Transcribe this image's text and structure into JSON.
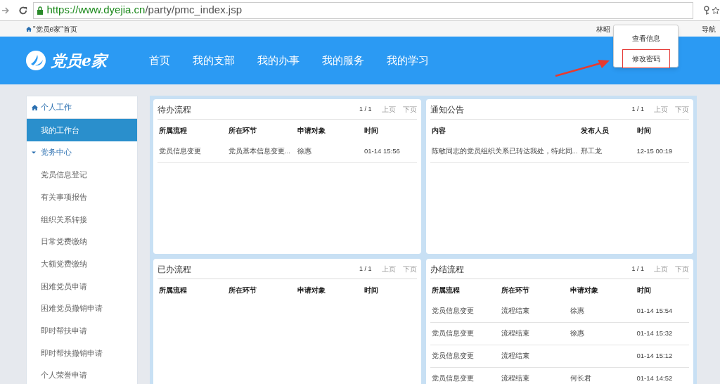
{
  "browser": {
    "url_host": "https://www.dyejia.cn",
    "url_path": "/party/pmc_index.jsp"
  },
  "topbar": {
    "breadcrumb": "\"党员e家\"首页",
    "user": "林昭",
    "right_link": "导航"
  },
  "user_menu": {
    "items": [
      {
        "label": "查看信息",
        "selected": false
      },
      {
        "label": "修改密码",
        "selected": true
      }
    ]
  },
  "header": {
    "logo": "党员e家",
    "nav": [
      {
        "label": "首页",
        "selected": false
      },
      {
        "label": "我的支部",
        "selected": false
      },
      {
        "label": "我的办事",
        "selected": false
      },
      {
        "label": "我的服务",
        "selected": false
      },
      {
        "label": "我的学习",
        "selected": false
      }
    ]
  },
  "sidebar": {
    "sections": [
      {
        "label": "个人工作",
        "kind": "home",
        "items": [
          {
            "label": "我的工作台",
            "selected": true
          }
        ]
      },
      {
        "label": "党务中心",
        "kind": "group",
        "expanded": true,
        "items": [
          {
            "label": "党员信息登记",
            "selected": false
          },
          {
            "label": "有关事项报告",
            "selected": false
          },
          {
            "label": "组织关系转接",
            "selected": false
          },
          {
            "label": "日常党费缴纳",
            "selected": false
          },
          {
            "label": "大额党费缴纳",
            "selected": false
          },
          {
            "label": "困难党员申请",
            "selected": false
          },
          {
            "label": "困难党员撤销申请",
            "selected": false
          },
          {
            "label": "即时帮扶申请",
            "selected": false
          },
          {
            "label": "即时帮扶撤销申请",
            "selected": false
          },
          {
            "label": "个人荣誉申请",
            "selected": false
          }
        ]
      }
    ]
  },
  "panels": [
    {
      "title": "待办流程",
      "page": "1 / 1",
      "pager": [
        "上页",
        "下页"
      ],
      "columns": [
        "所属流程",
        "所在环节",
        "申请对象",
        "时间"
      ],
      "rows": [
        [
          "党员信息变更",
          "党员基本信息变更...",
          "徐惠",
          "01-14 15:56"
        ]
      ]
    },
    {
      "title": "通知公告",
      "page": "1 / 1",
      "pager": [
        "上页",
        "下页"
      ],
      "columns": [
        "内容",
        "发布人员",
        "时间"
      ],
      "rows": [
        [
          "陈敏同志的党员组织关系已转达我处，特此同...",
          "邢工龙",
          "12-15 00:19"
        ]
      ]
    },
    {
      "title": "已办流程",
      "page": "1 / 1",
      "pager": [
        "上页",
        "下页"
      ],
      "columns": [
        "所属流程",
        "所在环节",
        "申请对象",
        "时间"
      ]
    },
    {
      "title": "办结流程",
      "page": "1 / 1",
      "pager": [
        "上页",
        "下页"
      ],
      "columns": [
        "所属流程",
        "所在环节",
        "申请对象",
        "时间"
      ],
      "rows": [
        [
          "党员信息变更",
          "流程结束",
          "徐惠",
          "01-14 15:54"
        ],
        [
          "党员信息变更",
          "流程结束",
          "徐惠",
          "01-14 15:32"
        ],
        [
          "党员信息变更",
          "流程结束",
          "",
          "01-14 15:12"
        ],
        [
          "党员信息变更",
          "流程结束",
          "何长君",
          "01-14 14:52"
        ]
      ]
    }
  ]
}
